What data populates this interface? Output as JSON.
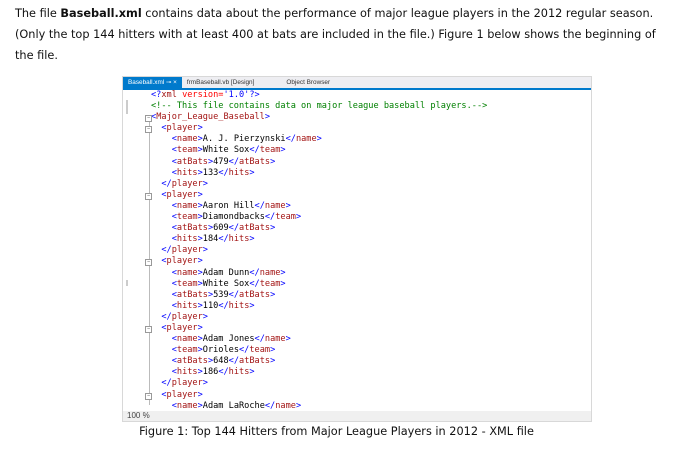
{
  "paragraph": {
    "t1": "The file ",
    "bold": "Baseball.xml",
    "t2": " contains data about the performance of major league players in the 2012 regular season. (Only the top 144 hitters with at least 400 at bats are included in the file.) Figure 1 below shows the beginning of the file."
  },
  "editor": {
    "tabs": [
      {
        "label": "Baseball.xml",
        "pin": "⊸",
        "close": "×"
      },
      {
        "label": "frmBaseball.vb [Design]"
      },
      {
        "label": "Object Browser"
      }
    ],
    "xml_decl": {
      "open": "<?",
      "name": "xml",
      "attr": " version=",
      "val": "'1.0'",
      "close": "?>"
    },
    "comment": "<!-- This file contains data on major league baseball players.-->",
    "root": "Major_League_Baseball",
    "players": [
      {
        "name": "A. J. Pierzynski",
        "team": "White Sox",
        "atBats": "479",
        "hits": "133"
      },
      {
        "name": "Aaron Hill",
        "team": "Diamondbacks",
        "atBats": "609",
        "hits": "184"
      },
      {
        "name": "Adam Dunn",
        "team": "White Sox",
        "atBats": "539",
        "hits": "110"
      },
      {
        "name": "Adam Jones",
        "team": "Orioles",
        "atBats": "648",
        "hits": "186"
      },
      {
        "name": "Adam LaRoche"
      }
    ],
    "zoom": "100 %"
  },
  "caption": "Figure 1: Top 144 Hitters from Major League Players in 2012 - XML file"
}
